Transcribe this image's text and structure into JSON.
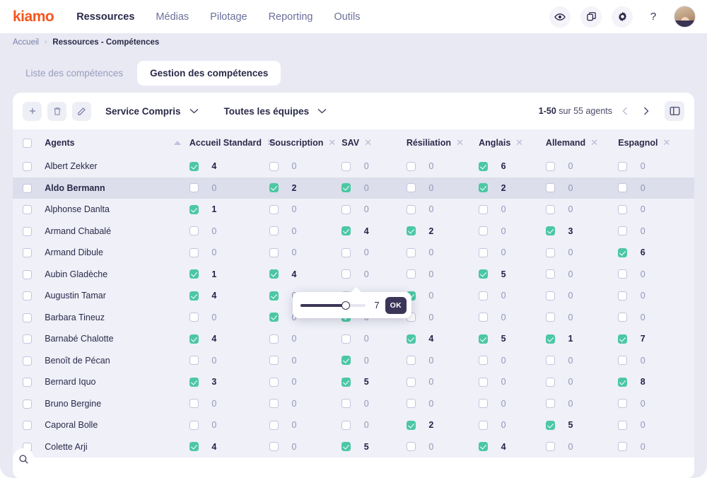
{
  "brand": {
    "logo_text": "kiamo",
    "logo_color": "#f4561d"
  },
  "nav": {
    "items": [
      {
        "label": "Ressources",
        "active": true
      },
      {
        "label": "Médias",
        "active": false
      },
      {
        "label": "Pilotage",
        "active": false
      },
      {
        "label": "Reporting",
        "active": false
      },
      {
        "label": "Outils",
        "active": false
      }
    ],
    "icons": [
      {
        "name": "eye-icon"
      },
      {
        "name": "copy-icon"
      },
      {
        "name": "gear-icon"
      },
      {
        "name": "help-icon",
        "glyph": "?"
      }
    ]
  },
  "breadcrumb": {
    "home": "Accueil",
    "separator": "›",
    "current": "Ressources - Compétences"
  },
  "tabs": [
    {
      "label": "Liste des compétences",
      "active": false
    },
    {
      "label": "Gestion des compétences",
      "active": true
    }
  ],
  "toolbar": {
    "add_label": "+",
    "delete_label": "delete",
    "edit_label": "edit",
    "service_select": "Service Compris",
    "team_select": "Toutes les équipes",
    "chevron": "⌄",
    "pagination": "1-50 sur 55 agents",
    "pagination_bold": "1-50",
    "pagination_rest": " sur 55 agents",
    "prev_label": "‹",
    "next_label": "›",
    "columns_button": "columns-settings"
  },
  "table": {
    "agents_header": "Agents",
    "skill_columns": [
      "Accueil Standard",
      "Souscription",
      "SAV",
      "Résiliation",
      "Anglais",
      "Allemand",
      "Espagnol"
    ],
    "close_glyph": "✕",
    "rows": [
      {
        "name": "Albert Zekker",
        "selected": false,
        "highlight": false,
        "skills": [
          {
            "on": true,
            "v": 4
          },
          {
            "on": false,
            "v": 0
          },
          {
            "on": false,
            "v": 0
          },
          {
            "on": false,
            "v": 0
          },
          {
            "on": true,
            "v": 6
          },
          {
            "on": false,
            "v": 0
          },
          {
            "on": false,
            "v": 0
          }
        ]
      },
      {
        "name": "Aldo Bermann",
        "selected": false,
        "highlight": true,
        "skills": [
          {
            "on": false,
            "v": 0
          },
          {
            "on": true,
            "v": 2
          },
          {
            "on": true,
            "v": 0
          },
          {
            "on": false,
            "v": 0
          },
          {
            "on": true,
            "v": 2
          },
          {
            "on": false,
            "v": 0
          },
          {
            "on": false,
            "v": 0
          }
        ]
      },
      {
        "name": "Alphonse Danlta",
        "selected": false,
        "highlight": false,
        "skills": [
          {
            "on": true,
            "v": 1
          },
          {
            "on": false,
            "v": 0
          },
          {
            "on": false,
            "v": 0
          },
          {
            "on": false,
            "v": 0
          },
          {
            "on": false,
            "v": 0
          },
          {
            "on": false,
            "v": 0
          },
          {
            "on": false,
            "v": 0
          }
        ]
      },
      {
        "name": "Armand Chabalé",
        "selected": false,
        "highlight": false,
        "skills": [
          {
            "on": false,
            "v": 0
          },
          {
            "on": false,
            "v": 0
          },
          {
            "on": true,
            "v": 4
          },
          {
            "on": true,
            "v": 2
          },
          {
            "on": false,
            "v": 0
          },
          {
            "on": true,
            "v": 3
          },
          {
            "on": false,
            "v": 0
          }
        ]
      },
      {
        "name": "Armand Dibule",
        "selected": false,
        "highlight": false,
        "skills": [
          {
            "on": false,
            "v": 0
          },
          {
            "on": false,
            "v": 0
          },
          {
            "on": false,
            "v": 0
          },
          {
            "on": false,
            "v": 0
          },
          {
            "on": false,
            "v": 0
          },
          {
            "on": false,
            "v": 0
          },
          {
            "on": true,
            "v": 6
          }
        ]
      },
      {
        "name": "Aubin Gladèche",
        "selected": false,
        "highlight": false,
        "skills": [
          {
            "on": true,
            "v": 1
          },
          {
            "on": true,
            "v": 4
          },
          {
            "on": false,
            "v": 0
          },
          {
            "on": false,
            "v": 0
          },
          {
            "on": true,
            "v": 5
          },
          {
            "on": false,
            "v": 0
          },
          {
            "on": false,
            "v": 0
          }
        ]
      },
      {
        "name": "Augustin Tamar",
        "selected": false,
        "highlight": false,
        "skills": [
          {
            "on": true,
            "v": 4
          },
          {
            "on": true,
            "v": 0
          },
          {
            "on": false,
            "v": 0
          },
          {
            "on": true,
            "v": 0
          },
          {
            "on": false,
            "v": 0
          },
          {
            "on": false,
            "v": 0
          },
          {
            "on": false,
            "v": 0
          }
        ]
      },
      {
        "name": "Barbara Tineuz",
        "selected": false,
        "highlight": false,
        "skills": [
          {
            "on": false,
            "v": 0
          },
          {
            "on": true,
            "v": 0
          },
          {
            "on": true,
            "v": 0
          },
          {
            "on": false,
            "v": 0
          },
          {
            "on": false,
            "v": 0
          },
          {
            "on": false,
            "v": 0
          },
          {
            "on": false,
            "v": 0
          }
        ]
      },
      {
        "name": "Barnabé Chalotte",
        "selected": false,
        "highlight": false,
        "skills": [
          {
            "on": true,
            "v": 4
          },
          {
            "on": false,
            "v": 0
          },
          {
            "on": false,
            "v": 0
          },
          {
            "on": true,
            "v": 4
          },
          {
            "on": true,
            "v": 5
          },
          {
            "on": true,
            "v": 1
          },
          {
            "on": true,
            "v": 7
          }
        ]
      },
      {
        "name": "Benoît de Pécan",
        "selected": false,
        "highlight": false,
        "skills": [
          {
            "on": false,
            "v": 0
          },
          {
            "on": false,
            "v": 0
          },
          {
            "on": true,
            "v": 0
          },
          {
            "on": false,
            "v": 0
          },
          {
            "on": false,
            "v": 0
          },
          {
            "on": false,
            "v": 0
          },
          {
            "on": false,
            "v": 0
          }
        ]
      },
      {
        "name": "Bernard Iquo",
        "selected": false,
        "highlight": false,
        "skills": [
          {
            "on": true,
            "v": 3
          },
          {
            "on": false,
            "v": 0
          },
          {
            "on": true,
            "v": 5
          },
          {
            "on": false,
            "v": 0
          },
          {
            "on": false,
            "v": 0
          },
          {
            "on": false,
            "v": 0
          },
          {
            "on": true,
            "v": 8
          }
        ]
      },
      {
        "name": "Bruno Bergine",
        "selected": false,
        "highlight": false,
        "skills": [
          {
            "on": false,
            "v": 0
          },
          {
            "on": false,
            "v": 0
          },
          {
            "on": false,
            "v": 0
          },
          {
            "on": false,
            "v": 0
          },
          {
            "on": false,
            "v": 0
          },
          {
            "on": false,
            "v": 0
          },
          {
            "on": false,
            "v": 0
          }
        ]
      },
      {
        "name": "Caporal Bolle",
        "selected": false,
        "highlight": false,
        "skills": [
          {
            "on": false,
            "v": 0
          },
          {
            "on": false,
            "v": 0
          },
          {
            "on": false,
            "v": 0
          },
          {
            "on": true,
            "v": 2
          },
          {
            "on": false,
            "v": 0
          },
          {
            "on": true,
            "v": 5
          },
          {
            "on": false,
            "v": 0
          }
        ]
      },
      {
        "name": "Colette Arji",
        "selected": false,
        "highlight": false,
        "skills": [
          {
            "on": true,
            "v": 4
          },
          {
            "on": false,
            "v": 0
          },
          {
            "on": true,
            "v": 5
          },
          {
            "on": false,
            "v": 0
          },
          {
            "on": true,
            "v": 4
          },
          {
            "on": false,
            "v": 0
          },
          {
            "on": false,
            "v": 0
          }
        ]
      }
    ]
  },
  "popover": {
    "value": "7",
    "ok_label": "OK",
    "slider_percent": 70,
    "slider_fill_color": "#3b3557"
  },
  "search_fab": {
    "name": "search-icon"
  },
  "colors": {
    "accent_orange": "#f4561d",
    "checkbox_on": "#4cc7a4",
    "dark": "#2a2a4a",
    "page_bg": "#e8e9f3"
  }
}
